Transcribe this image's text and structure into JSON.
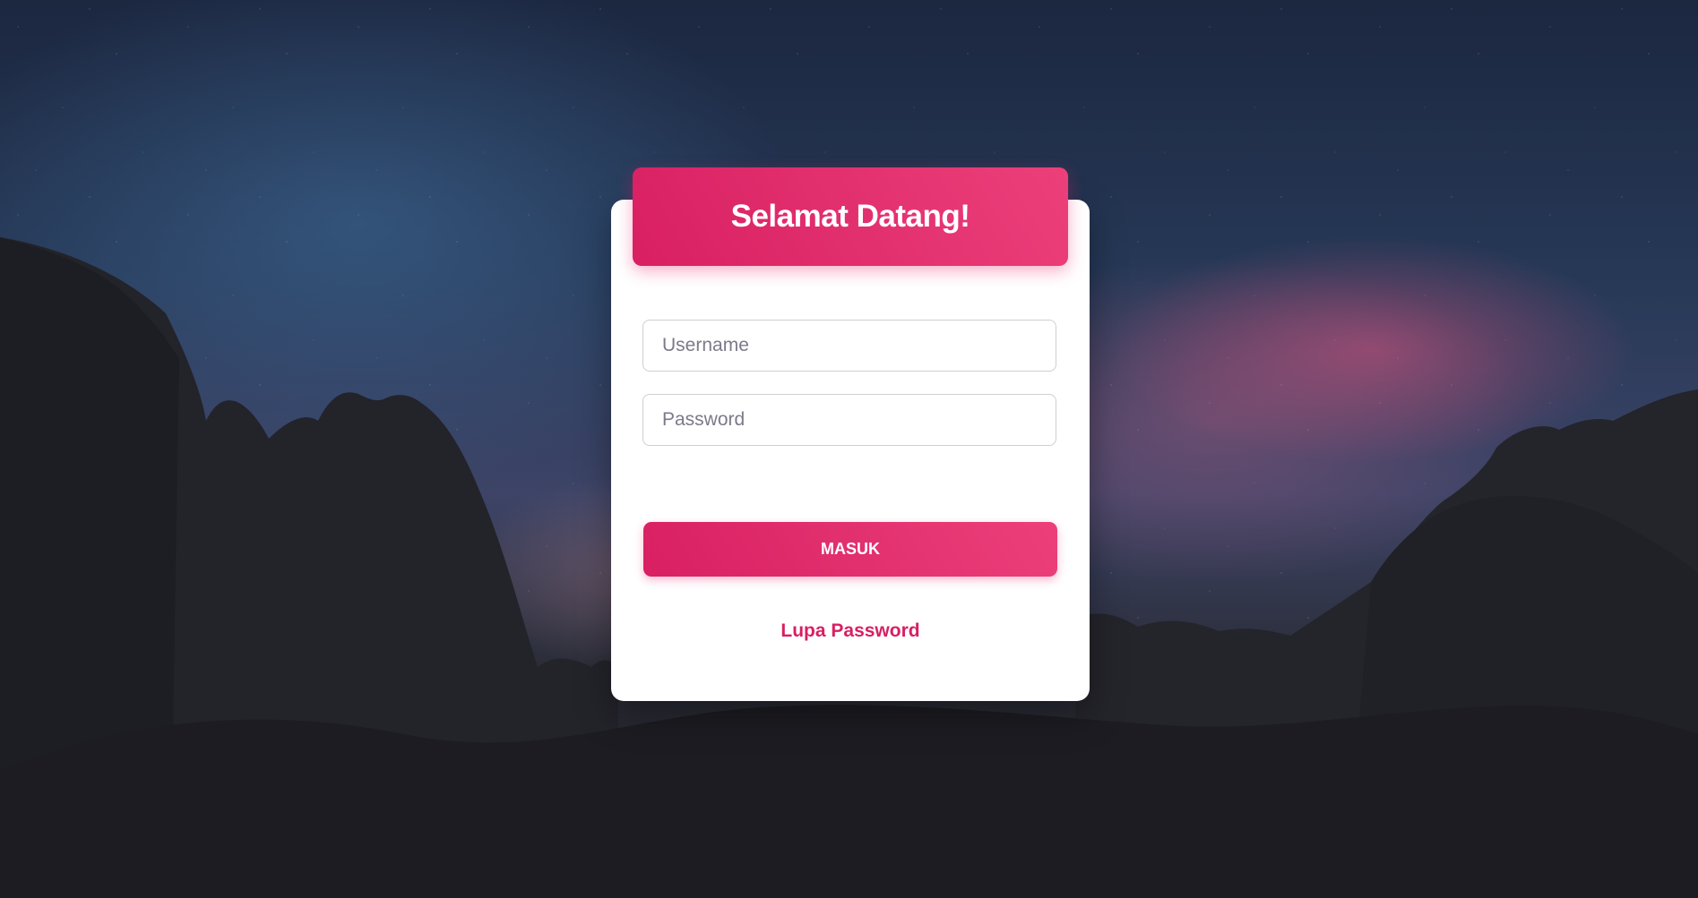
{
  "login": {
    "title": "Selamat Datang!",
    "username_placeholder": "Username",
    "password_placeholder": "Password",
    "submit_label": "MASUK",
    "forgot_label": "Lupa Password"
  },
  "colors": {
    "accent": "#e91e63",
    "accent_dark": "#d81f62",
    "card_bg": "#ffffff"
  }
}
